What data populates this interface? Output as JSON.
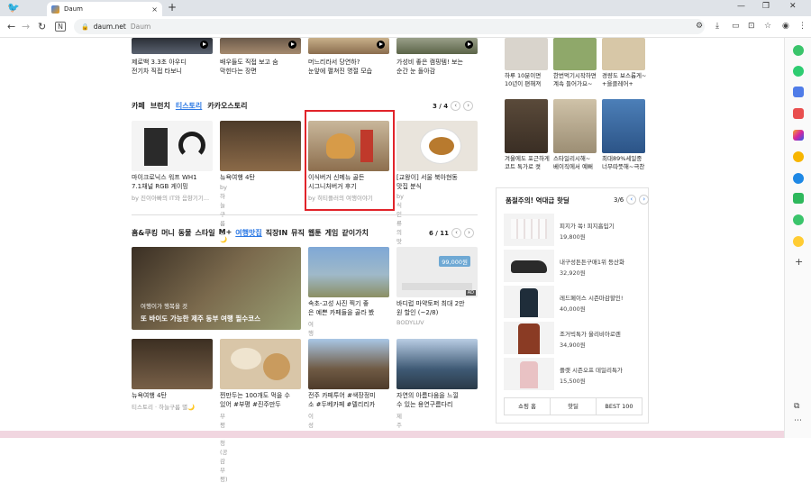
{
  "browser": {
    "tab_title": "Daum",
    "url_host": "daum.net",
    "url_site": "Daum"
  },
  "top_row": [
    {
      "caption": "제로백 3.3초 아우디\n전기차 직접 타보니"
    },
    {
      "caption": "배우들도 직접 보고 숨\n막힌다는 장면"
    },
    {
      "caption": "머느리라서 당연하?\n눈앞에 펼쳐진 명절 모습"
    },
    {
      "caption": "가성비 좋은 캠핑템! 보는\n순간 눈 돌아감"
    }
  ],
  "right_top": [
    {
      "caption": "하루 10분이면\n10년이 편해져"
    },
    {
      "caption": "한번먹기시작하면\n계속 들어가요~"
    },
    {
      "caption": "경량도 보스롭게~\n+을클레어+"
    },
    {
      "caption": "겨울에도 포근하게\n코트 톡가로 켯"
    },
    {
      "caption": "스타일리시해~\n베이직에서 예뻐"
    },
    {
      "caption": "최대89%세일중\n너무따뜻해~극찬"
    }
  ],
  "section1": {
    "tabs": [
      "카페",
      "브런치",
      "티스토리",
      "카카오스토리"
    ],
    "active_tab": "티스토리",
    "page": "3 / 4",
    "cards": [
      {
        "caption": "마이크로닉스 워프 WH1\n7.1채널 RGB 게이밍",
        "source": "by 진이아빠의 IT와 음향기기..."
      },
      {
        "caption": "뉴욕여행 4탄",
        "source": "by 하늘구름 별🌙"
      },
      {
        "caption": "이식버거 신메뉴 골든\n시그니처버거 후기",
        "source": "by 히티플러의 여행이야기"
      },
      {
        "caption": "[교왕이] 서울 북아현동\n맛집 분식",
        "source": "by 식인류의 맛집탐방"
      }
    ]
  },
  "section2": {
    "tabs": [
      "홈&쿠킹",
      "머니",
      "동물",
      "스타일",
      "M+",
      "여행맛집",
      "직장IN",
      "뮤직",
      "웹툰",
      "게임",
      "같이가치"
    ],
    "active_tab": "여행맛집",
    "page": "6 / 11",
    "big_overlay": "여행이가 행복을 것",
    "big_caption": "또 바이도 가능한 제주 동부 여행 필수코스",
    "cards": [
      {
        "caption": "속초-고성 사진 찍기 좋\n은 예쁜 카페들을 골라 봤",
        "source": "여행이가 행복을 것"
      },
      {
        "caption": "바디럽 마약토퍼 최대 2만\n원 할인 (~2/8)",
        "source": "BODYLUV",
        "badge": "99,000원",
        "ad": "AD"
      },
      {
        "caption": "뉴욕여행 4탄",
        "source": "티스토리 · 하늘구름 별🌙"
      },
      {
        "caption": "찐만두는 100개도 먹을 수\n있어 #부평 #진주만두",
        "source": "부평구청(공감부평)"
      },
      {
        "caption": "전주 카페투어 #색장정미\n소 #두베카페 #델리리카",
        "source": "이성두"
      },
      {
        "caption": "자연의 아름다움을 느낄\n수 있는 용연구름다리",
        "source": "제주시"
      }
    ]
  },
  "warning": {
    "title": "품절주의! 역대급 핫딜",
    "page": "3/6",
    "products": [
      {
        "name": "피지가 쏙! 피지흡입기",
        "price": "19,800원"
      },
      {
        "name": "내구성튼튼구매1위 등산화",
        "price": "32,920원"
      },
      {
        "name": "레드페이스 시즌마감할인!",
        "price": "40,000원"
      },
      {
        "name": "조거빅톡가 울리비아로렌",
        "price": "34,900원"
      },
      {
        "name": "플랫 시즌오프 데일리특가",
        "price": "15,500원"
      }
    ],
    "tabs": [
      "쇼핑 홈",
      "핫딜",
      "BEST 100"
    ]
  },
  "colors": {
    "accent": "#2b78e4",
    "highlight": "#e1232a"
  }
}
